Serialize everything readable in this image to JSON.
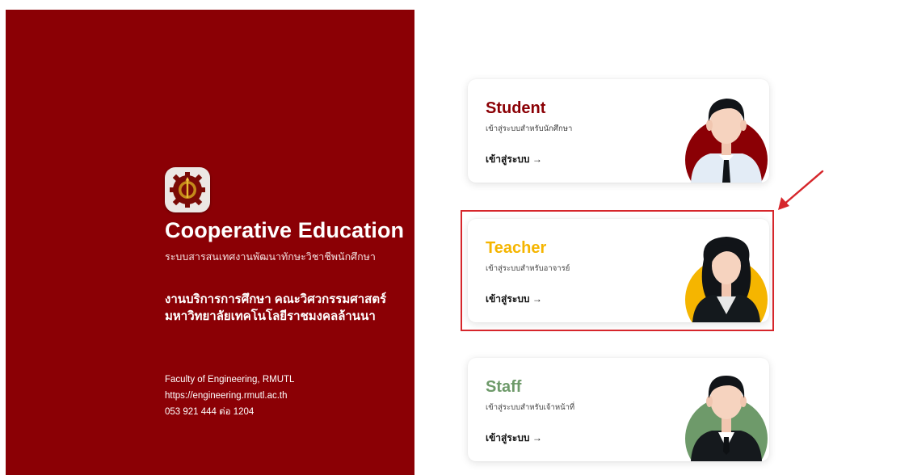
{
  "colors": {
    "brand": "#8b0005",
    "student_accent": "#8b0005",
    "teacher_accent": "#f5b500",
    "staff_accent": "#6e9a6a",
    "highlight": "#d6262b"
  },
  "branding": {
    "logo_icon": "rmutl-gear-torch-logo",
    "title": "Cooperative Education",
    "subtitle": "ระบบสารสนเทศงานพัฒนาทักษะวิชาชีพนักศึกษา"
  },
  "department": {
    "line1": "งานบริการการศึกษา คณะวิศวกรรมศาสตร์",
    "line2": "มหาวิทยาลัยเทคโนโลยีราชมงคลล้านนา"
  },
  "contact": {
    "faculty": "Faculty of Engineering, RMUTL",
    "website": "https://engineering.rmutl.ac.th",
    "phone": "053 921 444 ต่อ 1204"
  },
  "cards": [
    {
      "role": "Student",
      "subtitle": "เข้าสู่ระบบสำหรับนักศึกษา",
      "enter": "เข้าสู่ระบบ →",
      "icon": "student-avatar-icon"
    },
    {
      "role": "Teacher",
      "subtitle": "เข้าสู่ระบบสำหรับอาจารย์",
      "enter": "เข้าสู่ระบบ →",
      "icon": "teacher-avatar-icon"
    },
    {
      "role": "Staff",
      "subtitle": "เข้าสู่ระบบสำหรับเจ้าหน้าที่",
      "enter": "เข้าสู่ระบบ →",
      "icon": "staff-avatar-icon"
    }
  ]
}
